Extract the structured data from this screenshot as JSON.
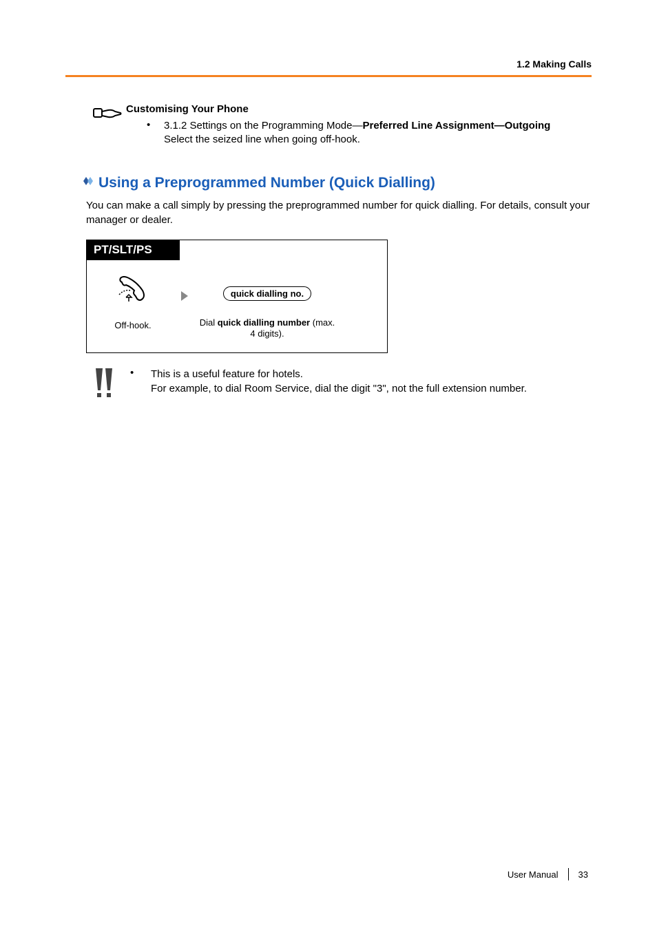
{
  "header": {
    "breadcrumb": "1.2 Making Calls"
  },
  "customising": {
    "title": "Customising Your Phone",
    "bullet_prefix": "3.1.2 Settings on the Programming Mode—",
    "bullet_bold": "Preferred Line Assignment—Outgoing",
    "bullet_line2": "Select the seized line when going off-hook."
  },
  "section": {
    "heading": "Using a Preprogrammed Number (Quick Dialling)",
    "intro": "You can make a call simply by pressing the preprogrammed number for quick dialling. For details, consult your manager or dealer."
  },
  "procedure": {
    "header": "PT/SLT/PS",
    "step1_label": "Off-hook.",
    "pill_label": "quick dialling no.",
    "step2_prefix": "Dial ",
    "step2_bold": "quick dialling number",
    "step2_suffix": " (max. 4 digits)."
  },
  "note": {
    "line1": "This is a useful feature for hotels.",
    "line2": "For example, to dial Room Service, dial the digit \"3\", not the full extension number."
  },
  "footer": {
    "manual": "User Manual",
    "page": "33"
  }
}
